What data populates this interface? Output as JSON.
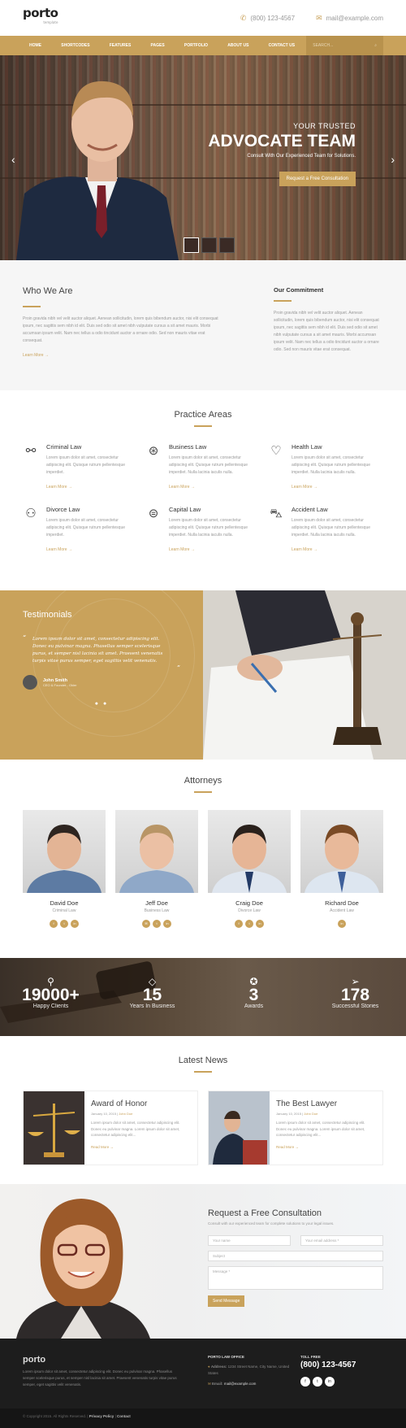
{
  "header": {
    "logo": "porto",
    "logo_sub": "template",
    "phone": "(800) 123-4567",
    "email": "mail@example.com"
  },
  "nav": {
    "items": [
      "HOME ˅",
      "SHORTCODES ˅",
      "FEATURES ˅",
      "PAGES ˅",
      "PORTFOLIO ˅",
      "ABOUT US ˅",
      "CONTACT US ˅"
    ],
    "search_placeholder": "SEARCH..."
  },
  "hero": {
    "kicker": "YOUR TRUSTED",
    "title": "ADVOCATE TEAM",
    "subtitle": "Consult With Our Experienced Team for Solutions.",
    "button": "Request a Free Consultation"
  },
  "who": {
    "title": "Who We Are",
    "text": "Proin gravida nibh vel velit auctor aliquet. Aenean sollicitudin, lorem quis bibendum auctor, nisi elit consequat ipsum, nec sagittis sem nibh id elit. Duis sed odio sit amet nibh vulputate cursus a sit amet mauris. Morbi accumsan ipsum velit. Nam nec tellus a odio tincidunt auctor a ornare odio. Sed non mauris vitae erat consequat.",
    "more": "Learn More →",
    "commit_title": "Our Commitment",
    "commit_text": "Proin gravida nibh vel velit auctor aliquet. Aenean sollicitudin, lorem quis bibendum auctor, nisi elit consequat ipsum, nec sagittis sem nibh id elit. Duis sed odio sit amet nibh vulputate cursus a sit amet mauris. Morbi accumsan ipsum velit. Nam nec tellus a odio tincidunt auctor a ornare odio. Sed non mauris vitae erat consequat."
  },
  "practice": {
    "title": "Practice Areas",
    "items": [
      {
        "title": "Criminal Law",
        "text": "Lorem ipsum dolor sit amet, consectetur adipiscing elit. Quisque rutrum pellentesque imperdiet.",
        "more": "Learn More →"
      },
      {
        "title": "Business Law",
        "text": "Lorem ipsum dolor sit amet, consectetur adipiscing elit. Quisque rutrum pellentesque imperdiet. Nulla lacinia iaculis nulla.",
        "more": "Learn More →"
      },
      {
        "title": "Health Law",
        "text": "Lorem ipsum dolor sit amet, consectetur adipiscing elit. Quisque rutrum pellentesque imperdiet. Nulla lacinia iaculis nulla.",
        "more": "Learn More →"
      },
      {
        "title": "Divorce Law",
        "text": "Lorem ipsum dolor sit amet, consectetur adipiscing elit. Quisque rutrum pellentesque imperdiet.",
        "more": "Learn More →"
      },
      {
        "title": "Capital Law",
        "text": "Lorem ipsum dolor sit amet, consectetur adipiscing elit. Quisque rutrum pellentesque imperdiet. Nulla lacinia iaculis nulla.",
        "more": "Learn More →"
      },
      {
        "title": "Accident Law",
        "text": "Lorem ipsum dolor sit amet, consectetur adipiscing elit. Quisque rutrum pellentesque imperdiet. Nulla lacinia iaculis nulla.",
        "more": "Learn More →"
      }
    ]
  },
  "testimonials": {
    "title": "Testimonials",
    "quote": "Lorem ipsum dolor sit amet, consectetur adipiscing elit. Donec eu pulvinar magna. Phasellus semper scelerisque purus, et semper nisl lacinia sit amet. Praesent venenatis turpis vitae purus semper, eget sagittis velit venenatis.",
    "name": "John Smith",
    "role": "CEO & Founder - Okler"
  },
  "attorneys": {
    "title": "Attorneys",
    "items": [
      {
        "name": "David Doe",
        "role": "Criminal Law",
        "social": [
          "f",
          "t",
          "in"
        ]
      },
      {
        "name": "Jeff Doe",
        "role": "Business Law",
        "social": [
          "✉",
          "t",
          "in"
        ]
      },
      {
        "name": "Craig Doe",
        "role": "Divorce Law",
        "social": [
          "f",
          "t",
          "in"
        ]
      },
      {
        "name": "Richard Doe",
        "role": "Accident Law",
        "social": [
          "in"
        ]
      }
    ]
  },
  "stats": [
    {
      "number": "19000+",
      "label": "Happy Clients"
    },
    {
      "number": "15",
      "label": "Years In Business"
    },
    {
      "number": "3",
      "label": "Awards"
    },
    {
      "number": "178",
      "label": "Successful Stories"
    }
  ],
  "news": {
    "title": "Latest News",
    "items": [
      {
        "title": "Award of Honor",
        "date": "January 10, 2015",
        "author": "John Doe",
        "text": "Lorem ipsum dolor sit amet, consectetur adipiscing elit. Donec eu pulvinar magna. Lorem ipsum dolor sit amet, consectetur adipiscing elit...",
        "more": "Read More →"
      },
      {
        "title": "The Best Lawyer",
        "date": "January 10, 2015",
        "author": "John Doe",
        "text": "Lorem ipsum dolor sit amet, consectetur adipiscing elit. Donec eu pulvinar magna. Lorem ipsum dolor sit amet, consectetur adipiscing elit...",
        "more": "Read More →"
      }
    ]
  },
  "consult": {
    "title": "Request a Free Consultation",
    "subtitle": "Consult with our experienced team for complete solutions to your legal issues.",
    "name_ph": "Your name",
    "email_ph": "Your email address *",
    "subject_ph": "Subject",
    "message_ph": "Message *",
    "button": "Send Message"
  },
  "footer": {
    "logo": "porto",
    "text": "Lorem ipsum dolor sit amet, consectetur adipiscing elit. Donec eu pulvinar magna. Phasellus semper scelerisque purus, et semper nisl lacinia sit amet. Praesent venenatis turpis vitae purus semper, eget sagittis velit venenatis.",
    "office_title": "PORTO LAW OFFICE",
    "address_label": "Address:",
    "address": "1234 Street Name, City Name, United States",
    "email_label": "Email:",
    "email": "mail@example.com",
    "toll_title": "TOLL FREE",
    "phone": "(800) 123-4567",
    "social": [
      "f",
      "t",
      "in"
    ],
    "copyright": "© Copyright 2015. All Rights Reserved.",
    "privacy": "Privacy Policy",
    "contact": "Contact"
  },
  "colors": {
    "accent": "#c9a25b",
    "dark": "#1d1d1d"
  }
}
